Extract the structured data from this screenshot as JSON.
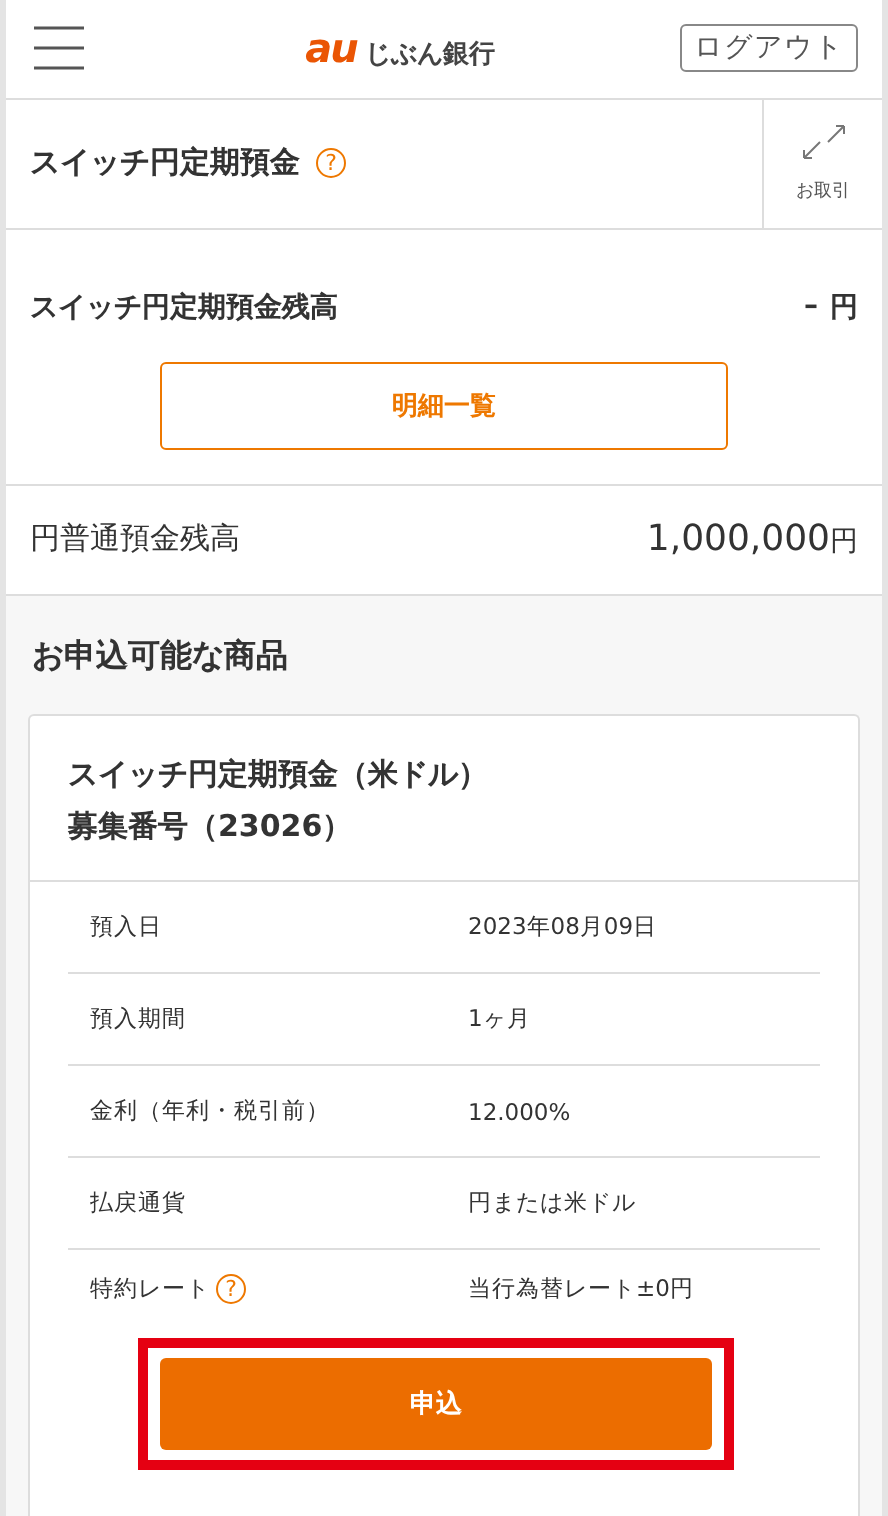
{
  "header": {
    "logo_mark": "au",
    "logo_text": "じぶん銀行",
    "logout": "ログアウト"
  },
  "account": {
    "title": "スイッチ円定期預金",
    "help": "?",
    "transactions": "お取引"
  },
  "balance": {
    "label": "スイッチ円定期預金残高",
    "value": "–",
    "unit": "円",
    "details_button": "明細一覧"
  },
  "yen_balance": {
    "label": "円普通預金残高",
    "value": "1,000,000",
    "unit": "円"
  },
  "products": {
    "heading": "お申込可能な商品",
    "card": {
      "title": "スイッチ円定期預金（米ドル）",
      "subtitle": "募集番号（23026）",
      "rows": [
        {
          "label": "預入日",
          "value": "2023年08月09日"
        },
        {
          "label": "預入期間",
          "value": "1ヶ月"
        },
        {
          "label": "金利（年利・税引前）",
          "value": "12.000%"
        },
        {
          "label": "払戻通貨",
          "value": "円または米ドル"
        },
        {
          "label": "特約レート",
          "help": "?",
          "value": "当行為替レート±0円"
        }
      ],
      "apply_button": "申込",
      "apply_highlighted": true
    }
  }
}
